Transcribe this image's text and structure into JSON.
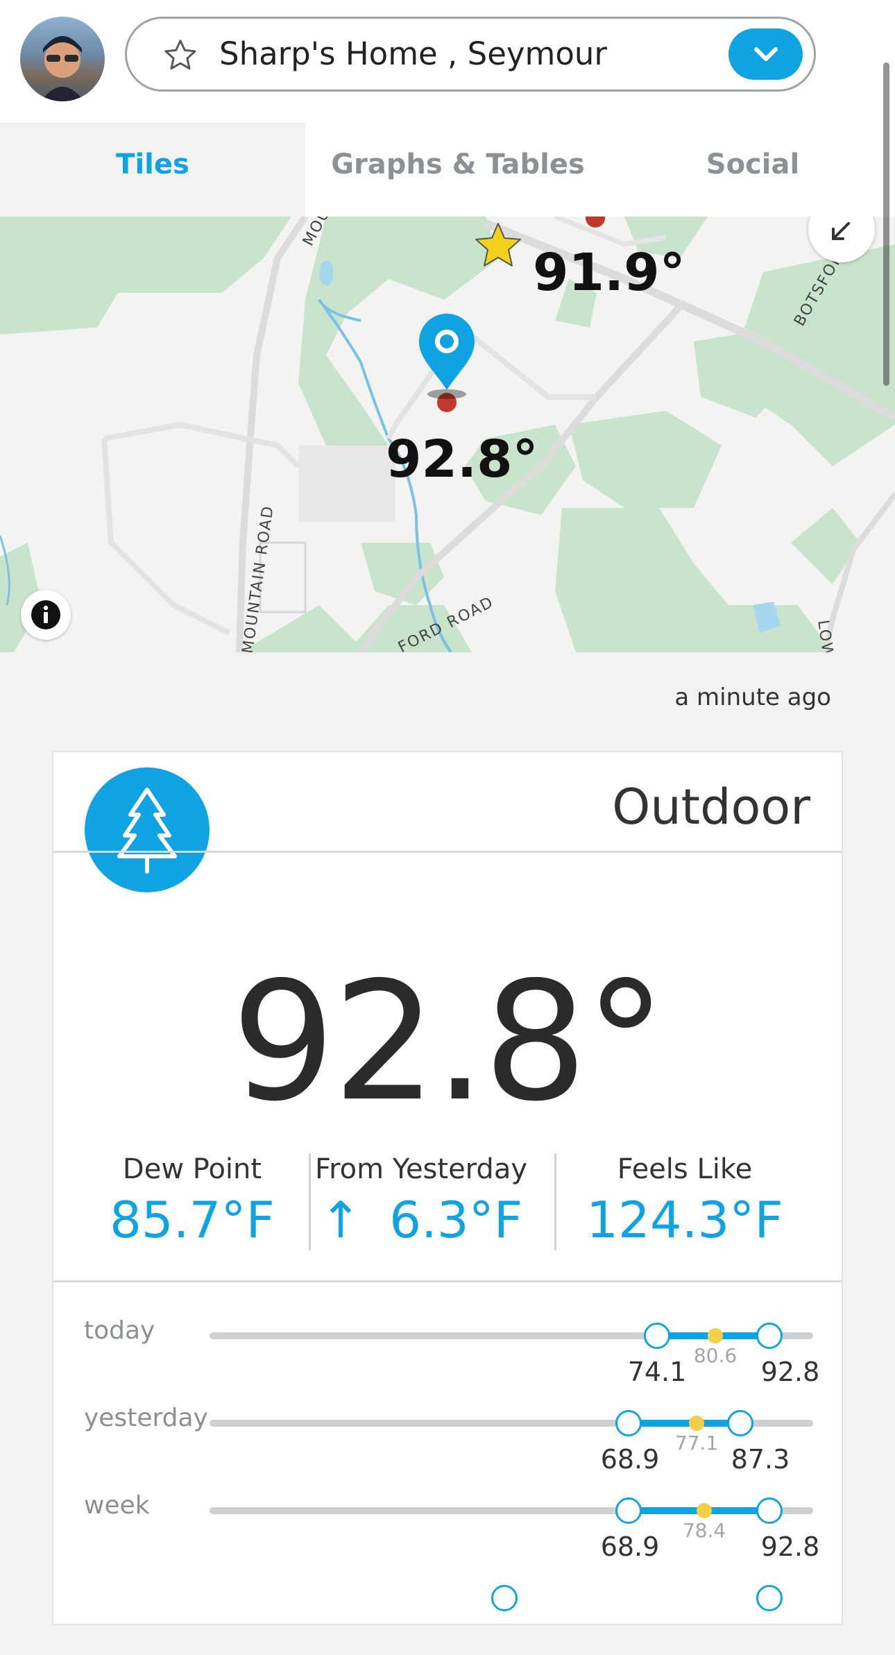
{
  "header": {
    "location_name": "Sharp's Home , Seymour"
  },
  "tabs": [
    {
      "label": "Tiles",
      "active": true
    },
    {
      "label": "Graphs & Tables",
      "active": false
    },
    {
      "label": "Social",
      "active": false
    }
  ],
  "map": {
    "station_temps": [
      "91.9°",
      "92.8°"
    ],
    "road_labels": [
      "MOUNT",
      "MOUNTAIN ROAD",
      "FORD ROAD",
      "BOTSFORD",
      "LOW"
    ]
  },
  "updated": "a minute ago",
  "card": {
    "title": "Outdoor",
    "icon": "tree-icon",
    "temperature": "92.8°",
    "stats": {
      "dew_point": {
        "label": "Dew Point",
        "value": "85.7°F"
      },
      "from_yesterday": {
        "label": "From Yesterday",
        "arrow": "↑",
        "value": "6.3°F"
      },
      "feels_like": {
        "label": "Feels Like",
        "value": "124.3°F"
      }
    },
    "ranges": [
      {
        "label": "today",
        "low": "74.1",
        "avg": "80.6",
        "high": "92.8"
      },
      {
        "label": "yesterday",
        "low": "68.9",
        "avg": "77.1",
        "high": "87.3"
      },
      {
        "label": "week",
        "low": "68.9",
        "avg": "78.4",
        "high": "92.8"
      }
    ]
  },
  "colors": {
    "accent": "#0fa3e3",
    "avg_marker": "#f3cf4a",
    "map_green": "#c9e4cc"
  }
}
